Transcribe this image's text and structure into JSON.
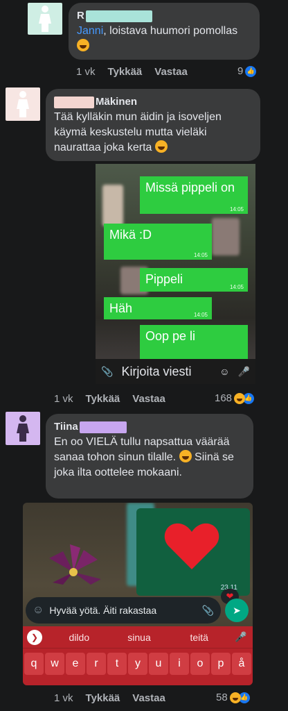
{
  "comments": [
    {
      "author_visible": "R",
      "mention": "Janni",
      "text": ", loistava huumori pomollas",
      "time": "1 vk",
      "like_label": "Tykkää",
      "reply_label": "Vastaa",
      "reaction_count": "9"
    },
    {
      "author_visible": "Mäkinen",
      "text": "Tää kylläkin mun äidin ja isoveljen käymä keskustelu mutta vieläki naurattaa joka kerta",
      "time": "1 vk",
      "like_label": "Tykkää",
      "reply_label": "Vastaa",
      "reaction_count": "168",
      "screenshot": {
        "messages": [
          {
            "text": "Missä pippeli on",
            "time": "14:05",
            "side": "out"
          },
          {
            "text": "Mikä :D",
            "time": "14:05",
            "side": "in"
          },
          {
            "text": "Pippeli",
            "time": "14:05",
            "side": "out"
          },
          {
            "text": "Häh",
            "time": "14:05",
            "side": "in"
          },
          {
            "text": "Oop pe li",
            "time": "",
            "side": "out"
          }
        ],
        "compose_placeholder": "Kirjoita viesti"
      }
    },
    {
      "author_visible": "Tiina",
      "text": "En oo VIELÄ tullu napsattua väärää sanaa tohon sinun tilalle.",
      "text2": "Siinä se joka ilta oottelee mokaani.",
      "time": "1 vk",
      "like_label": "Tykkää",
      "reply_label": "Vastaa",
      "reaction_count": "58",
      "screenshot": {
        "heart_time": "23.11",
        "compose_text": "Hyvää yötä. Äiti rakastaa",
        "suggestions": [
          "dildo",
          "sinua",
          "teitä"
        ],
        "keys": [
          "q",
          "w",
          "e",
          "r",
          "t",
          "y",
          "u",
          "i",
          "o",
          "p",
          "å"
        ]
      }
    }
  ],
  "colors": {
    "background": "#18191a",
    "bubble": "#3a3b3c",
    "mention": "#4599ff",
    "whatsapp_green": "#2ecc40",
    "keyboard_red": "#b7232a"
  }
}
